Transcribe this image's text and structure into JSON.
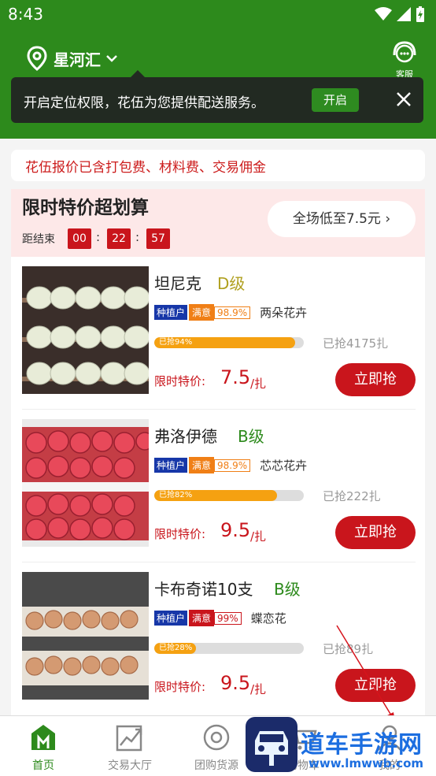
{
  "status_bar": {
    "time": "8:43"
  },
  "header": {
    "location": "星河汇",
    "service_label": "客服",
    "tip_text": "开启定位权限，花伍为您提供配送服务。",
    "tip_button": "开启",
    "accent_color": "#2d8a1c"
  },
  "notice": "花伍报价已含打包费、材料费、交易佣金",
  "flash_sale": {
    "title": "限时特价超划算",
    "countdown_label": "距结束",
    "hours": "00",
    "minutes": "22",
    "seconds": "57",
    "all_button": "全场低至7.5元 ›"
  },
  "products": [
    {
      "name": "坦尼克",
      "grade": "D级",
      "grade_color": "#b0a020",
      "grower": "种植户",
      "satisfaction": "满意",
      "rate": "98.9%",
      "shop": "两朵花卉",
      "progress_label": "已抢94%",
      "progress": 0.94,
      "sold": "已抢4175扎",
      "price_label": "限时特价:",
      "price": "7.5",
      "unit": "/扎",
      "buy": "立即抢"
    },
    {
      "name": "弗洛伊德",
      "grade": "B级",
      "grade_color": "#2d8a1c",
      "grower": "种植户",
      "satisfaction": "满意",
      "rate": "98.9%",
      "shop": "芯芯花卉",
      "progress_label": "已抢82%",
      "progress": 0.82,
      "sold": "已抢222扎",
      "price_label": "限时特价:",
      "price": "9.5",
      "unit": "/扎",
      "buy": "立即抢"
    },
    {
      "name": "卡布奇诺10支",
      "grade": "B级",
      "grade_color": "#2d8a1c",
      "grower": "种植户",
      "satisfaction": "满意",
      "rate": "99%",
      "shop": "蝶恋花",
      "progress_label": "已抢28%",
      "progress": 0.28,
      "sold": "已抢89扎",
      "price_label": "限时特价:",
      "price": "9.5",
      "unit": "/扎",
      "buy": "立即抢"
    }
  ],
  "tabs": [
    {
      "label": "首页",
      "icon": "home-icon"
    },
    {
      "label": "交易大厅",
      "icon": "chart-icon"
    },
    {
      "label": "团购货源",
      "icon": "target-icon"
    },
    {
      "label": "购物车",
      "icon": "cart-icon"
    },
    {
      "label": "我的",
      "icon": "person-icon"
    }
  ],
  "watermark": {
    "text": "道车手游网",
    "url": "www.lmwwb.com"
  }
}
